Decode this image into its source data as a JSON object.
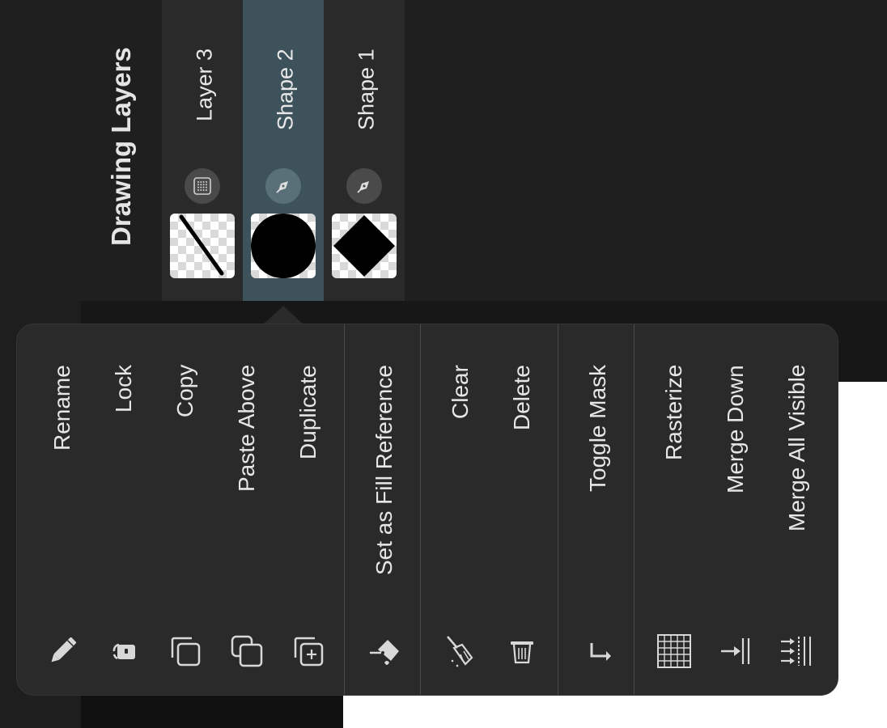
{
  "panel": {
    "title": "Drawing Layers",
    "layers": [
      {
        "name": "Layer 3",
        "badge": "raster-layer-icon",
        "thumbnail": "diagonal-line",
        "selected": false
      },
      {
        "name": "Shape 2",
        "badge": "pen-tool-icon",
        "thumbnail": "circle",
        "selected": true
      },
      {
        "name": "Shape 1",
        "badge": "pen-tool-icon",
        "thumbnail": "diamond",
        "selected": false
      }
    ]
  },
  "menu": {
    "groups": [
      [
        {
          "label": "Rename",
          "icon": "pencil-icon"
        },
        {
          "label": "Lock",
          "icon": "lock-icon"
        },
        {
          "label": "Copy",
          "icon": "copy-icon"
        },
        {
          "label": "Paste Above",
          "icon": "paste-above-icon"
        },
        {
          "label": "Duplicate",
          "icon": "duplicate-icon"
        }
      ],
      [
        {
          "label": "Set as Fill Reference",
          "icon": "fill-bucket-icon"
        }
      ],
      [
        {
          "label": "Clear",
          "icon": "broom-icon"
        },
        {
          "label": "Delete",
          "icon": "trash-icon"
        }
      ],
      [
        {
          "label": "Toggle Mask",
          "icon": "mask-arrow-icon"
        }
      ],
      [
        {
          "label": "Rasterize",
          "icon": "grid-icon"
        },
        {
          "label": "Merge Down",
          "icon": "merge-down-icon"
        },
        {
          "label": "Merge All Visible",
          "icon": "merge-all-icon"
        }
      ]
    ]
  },
  "colors": {
    "background": "#1c1c1c",
    "layer_selected": "#3e525b",
    "menu_bg": "#2a2a2a",
    "text": "#e6e6e6"
  }
}
